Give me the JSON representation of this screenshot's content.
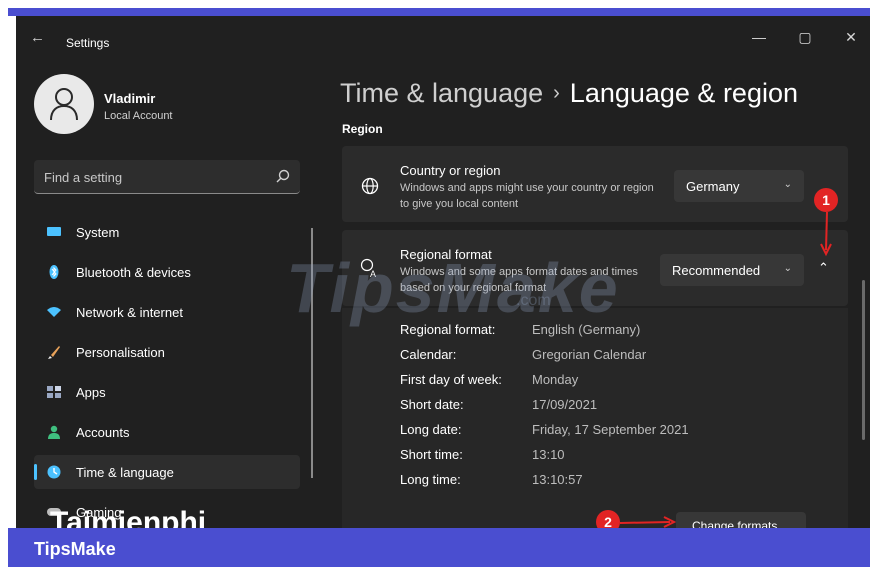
{
  "window": {
    "app_title": "Settings",
    "back_icon": "back-arrow-icon",
    "minimize_glyph": "—",
    "maximize_glyph": "▢",
    "close_glyph": "✕"
  },
  "user": {
    "name": "Vladimir",
    "account_type": "Local Account"
  },
  "search": {
    "placeholder": "Find a setting"
  },
  "sidebar": {
    "items": [
      {
        "label": "System",
        "icon": "monitor-icon",
        "color": "#4cc2ff"
      },
      {
        "label": "Bluetooth & devices",
        "icon": "bluetooth-icon",
        "color": "#4cc2ff"
      },
      {
        "label": "Network & internet",
        "icon": "wifi-icon",
        "color": "#4cc2ff"
      },
      {
        "label": "Personalisation",
        "icon": "brush-icon",
        "color": "#e8a25a"
      },
      {
        "label": "Apps",
        "icon": "apps-icon",
        "color": "#9aa8c4"
      },
      {
        "label": "Accounts",
        "icon": "person-icon",
        "color": "#3fbf7f"
      },
      {
        "label": "Time & language",
        "icon": "globe-clock-icon",
        "color": "#4cc2ff",
        "active": true
      },
      {
        "label": "Gaming",
        "icon": "gamepad-icon",
        "color": "#bdbdbd"
      }
    ]
  },
  "breadcrumb": {
    "parent": "Time & language",
    "separator": "›",
    "current": "Language & region"
  },
  "region": {
    "section_title": "Region",
    "country": {
      "title": "Country or region",
      "description": "Windows and apps might use your country or region to give you local content",
      "value": "Germany"
    },
    "regional_format": {
      "title": "Regional format",
      "description": "Windows and some apps format dates and times based on your regional format",
      "value": "Recommended"
    },
    "details": [
      {
        "label": "Regional format:",
        "value": "English (Germany)"
      },
      {
        "label": "Calendar:",
        "value": "Gregorian Calendar"
      },
      {
        "label": "First day of week:",
        "value": "Monday"
      },
      {
        "label": "Short date:",
        "value": "17/09/2021"
      },
      {
        "label": "Long date:",
        "value": "Friday, 17 September 2021"
      },
      {
        "label": "Short time:",
        "value": "13:10"
      },
      {
        "label": "Long time:",
        "value": "13:10:57"
      }
    ],
    "change_formats_label": "Change formats"
  },
  "annotations": {
    "badge_1": "1",
    "badge_2": "2",
    "badge_color": "#e22424"
  },
  "watermarks": {
    "center": "TipsMake",
    "center_suffix": ".com",
    "bottom": "Taimienphi"
  },
  "banner": {
    "text": "TipsMake",
    "color": "#4a4ed0"
  }
}
